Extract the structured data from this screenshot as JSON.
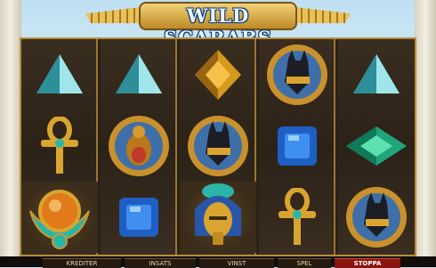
{
  "game": {
    "title": "WILD SCARABS",
    "reels": [
      [
        "teal-pyramid-gem-icon",
        "golden-ankh-icon",
        "orange-scarab-amulet-icon"
      ],
      [
        "teal-pyramid-gem-icon",
        "scarab-medallion-icon",
        "blue-square-gem-icon"
      ],
      [
        "gold-diamond-gem-icon",
        "anubis-medallion-icon",
        "pharaoh-head-icon"
      ],
      [
        "anubis-medallion-icon",
        "blue-square-gem-icon",
        "golden-ankh-icon"
      ],
      [
        "teal-pyramid-gem-icon",
        "green-diamond-gem-icon",
        "anubis-medallion-icon"
      ]
    ]
  },
  "controls": {
    "credits_label": "KREDITER",
    "bet_label": "INSATS",
    "win_label": "VINST",
    "play_label": "SPEL",
    "stop_label": "STOPPA"
  }
}
